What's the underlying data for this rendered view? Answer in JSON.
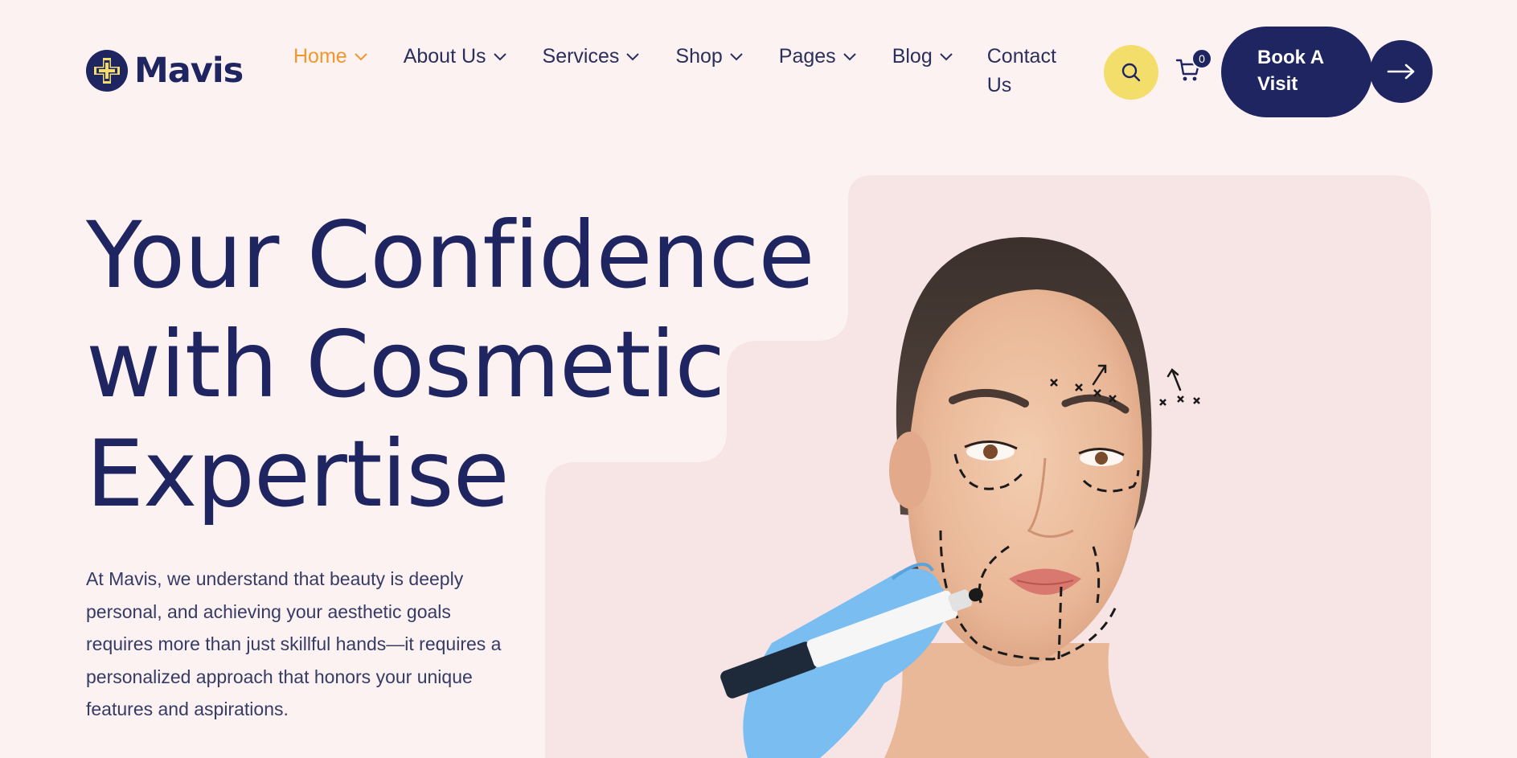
{
  "brand": {
    "name": "Mavis"
  },
  "nav": {
    "items": [
      {
        "label": "Home",
        "active": true
      },
      {
        "label": "About Us",
        "active": false
      },
      {
        "label": "Services",
        "active": false
      },
      {
        "label": "Shop",
        "active": false
      },
      {
        "label": "Pages",
        "active": false
      },
      {
        "label": "Blog",
        "active": false
      }
    ],
    "contact_label": "Contact Us"
  },
  "header_actions": {
    "search_icon": "search-icon",
    "cart_icon": "cart-icon",
    "cart_count": "0",
    "book_label": "Book A Visit",
    "arrow_icon": "arrow-right-icon"
  },
  "hero": {
    "title_lines": [
      "Your Confidence",
      "with Cosmetic",
      "Expertise"
    ],
    "description": "At Mavis, we understand that beauty is deeply personal, and achieving your aesthetic goals requires more than just skillful hands—it requires a personalized approach that honors your unique features and aspirations."
  },
  "colors": {
    "page_bg": "#fdf2f2",
    "panel_bg": "#f7e5e6",
    "navy": "#1f2560",
    "accent_orange": "#f1972c",
    "accent_yellow": "#f3de6b"
  }
}
